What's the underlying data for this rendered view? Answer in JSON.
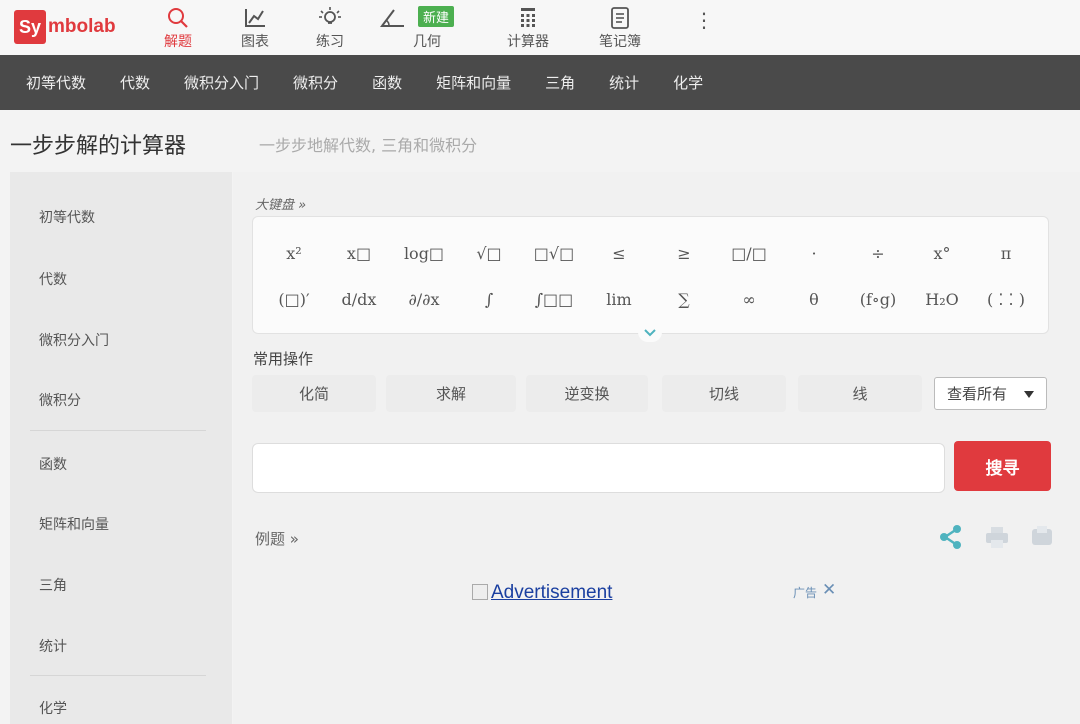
{
  "brand": {
    "logo_box": "Sy",
    "logo_rest": "mbolab",
    "accent": "#e03a3e",
    "badge_color": "#4caf50"
  },
  "topnav": {
    "items": [
      {
        "label": "解题",
        "icon": "search-icon"
      },
      {
        "label": "图表",
        "icon": "graph-icon"
      },
      {
        "label": "练习",
        "icon": "lightbulb-icon"
      },
      {
        "label": "几何",
        "icon": "angle-icon"
      },
      {
        "label": "计算器",
        "icon": "calculator-icon"
      },
      {
        "label": "笔记簿",
        "icon": "notebook-icon"
      }
    ],
    "new_badge": "新建",
    "more": "⋮"
  },
  "subjects": [
    "初等代数",
    "代数",
    "微积分入门",
    "微积分",
    "函数",
    "矩阵和向量",
    "三角",
    "统计",
    "化学"
  ],
  "page": {
    "title": "一步步解的计算器",
    "subtitle": "一步步地解代数, 三角和微积分"
  },
  "sidebar": [
    "初等代数",
    "代数",
    "微积分入门",
    "微积分",
    "函数",
    "矩阵和向量",
    "三角",
    "统计",
    "化学"
  ],
  "keyboard": {
    "title": "大键盘 »",
    "row1": [
      "x²",
      "x□",
      "log□",
      "√□",
      "□√□",
      "≤",
      "≥",
      "□/□",
      "·",
      "÷",
      "x°",
      "π"
    ],
    "row2": [
      "(□)′",
      "d/dx",
      "∂/∂x",
      "∫",
      "∫□□",
      "lim",
      "∑",
      "∞",
      "θ",
      "(f∘g)",
      "H₂O",
      "( ⁚ ⁚ )"
    ]
  },
  "operations": {
    "title": "常用操作",
    "buttons": [
      "化简",
      "求解",
      "逆变换",
      "切线",
      "线"
    ],
    "view_all": "查看所有"
  },
  "search": {
    "value": "",
    "placeholder": "",
    "button": "搜寻"
  },
  "examples": "例题 »",
  "actions": [
    "share-icon",
    "print-icon",
    "save-icon"
  ],
  "ad": {
    "text": "Advertisement",
    "label": "广告"
  }
}
